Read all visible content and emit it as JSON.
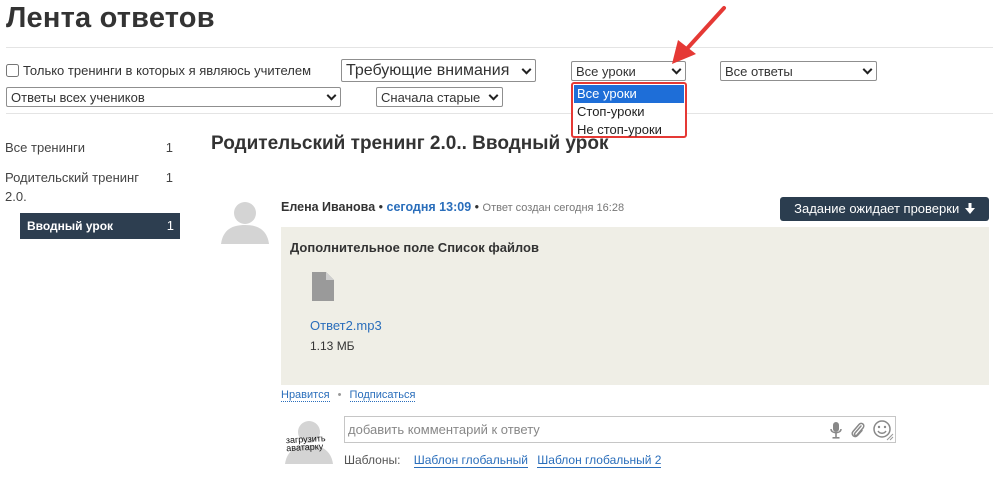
{
  "page": {
    "title": "Лента ответов"
  },
  "filters": {
    "teacher_only_label": "Только тренинги в которых я являюсь учителем",
    "attention_select": "Требующие внимания",
    "lessons_select": "Все уроки",
    "answers_select": "Все ответы",
    "students_select": "Ответы всех учеников",
    "sort_select": "Сначала старые"
  },
  "lessons_dropdown": {
    "options": [
      "Все уроки",
      "Стоп-уроки",
      "Не стоп-уроки"
    ],
    "selected_index": 0
  },
  "colors": {
    "highlight": "#e53935",
    "selected_option": "#1e6ed8",
    "dark_button": "#2b3d4f",
    "link": "#2a6ebb"
  },
  "sidebar": {
    "items": [
      {
        "label": "Все тренинги",
        "count": "1"
      },
      {
        "label": "Родительский тренинг 2.0.",
        "count": "1"
      }
    ],
    "active": {
      "label": "Вводный урок",
      "count": "1"
    }
  },
  "lesson": {
    "title": "Родительский тренинг 2.0.. Вводный урок"
  },
  "answer": {
    "author": "Елена Иванова",
    "separator": "•",
    "time": "сегодня 13:09",
    "created": "Ответ создан сегодня 16:28",
    "status_button": "Задание ожидает проверки",
    "status_icon": "arrow-down-icon",
    "field_title": "Дополнительное поле Список файлов",
    "file": {
      "name": "Ответ2.mp3",
      "size": "1.13 МБ",
      "icon": "file-icon"
    },
    "actions": {
      "like": "Нравится",
      "subscribe": "Подписаться",
      "dot": "•"
    }
  },
  "comment": {
    "upload_avatar": "загрузить аватарку",
    "placeholder": "добавить комментарий к ответу",
    "icons": [
      "microphone-icon",
      "paperclip-icon",
      "smiley-icon"
    ],
    "templates_label": "Шаблоны:",
    "templates": [
      "Шаблон глобальный",
      "Шаблон глобальный 2"
    ]
  }
}
